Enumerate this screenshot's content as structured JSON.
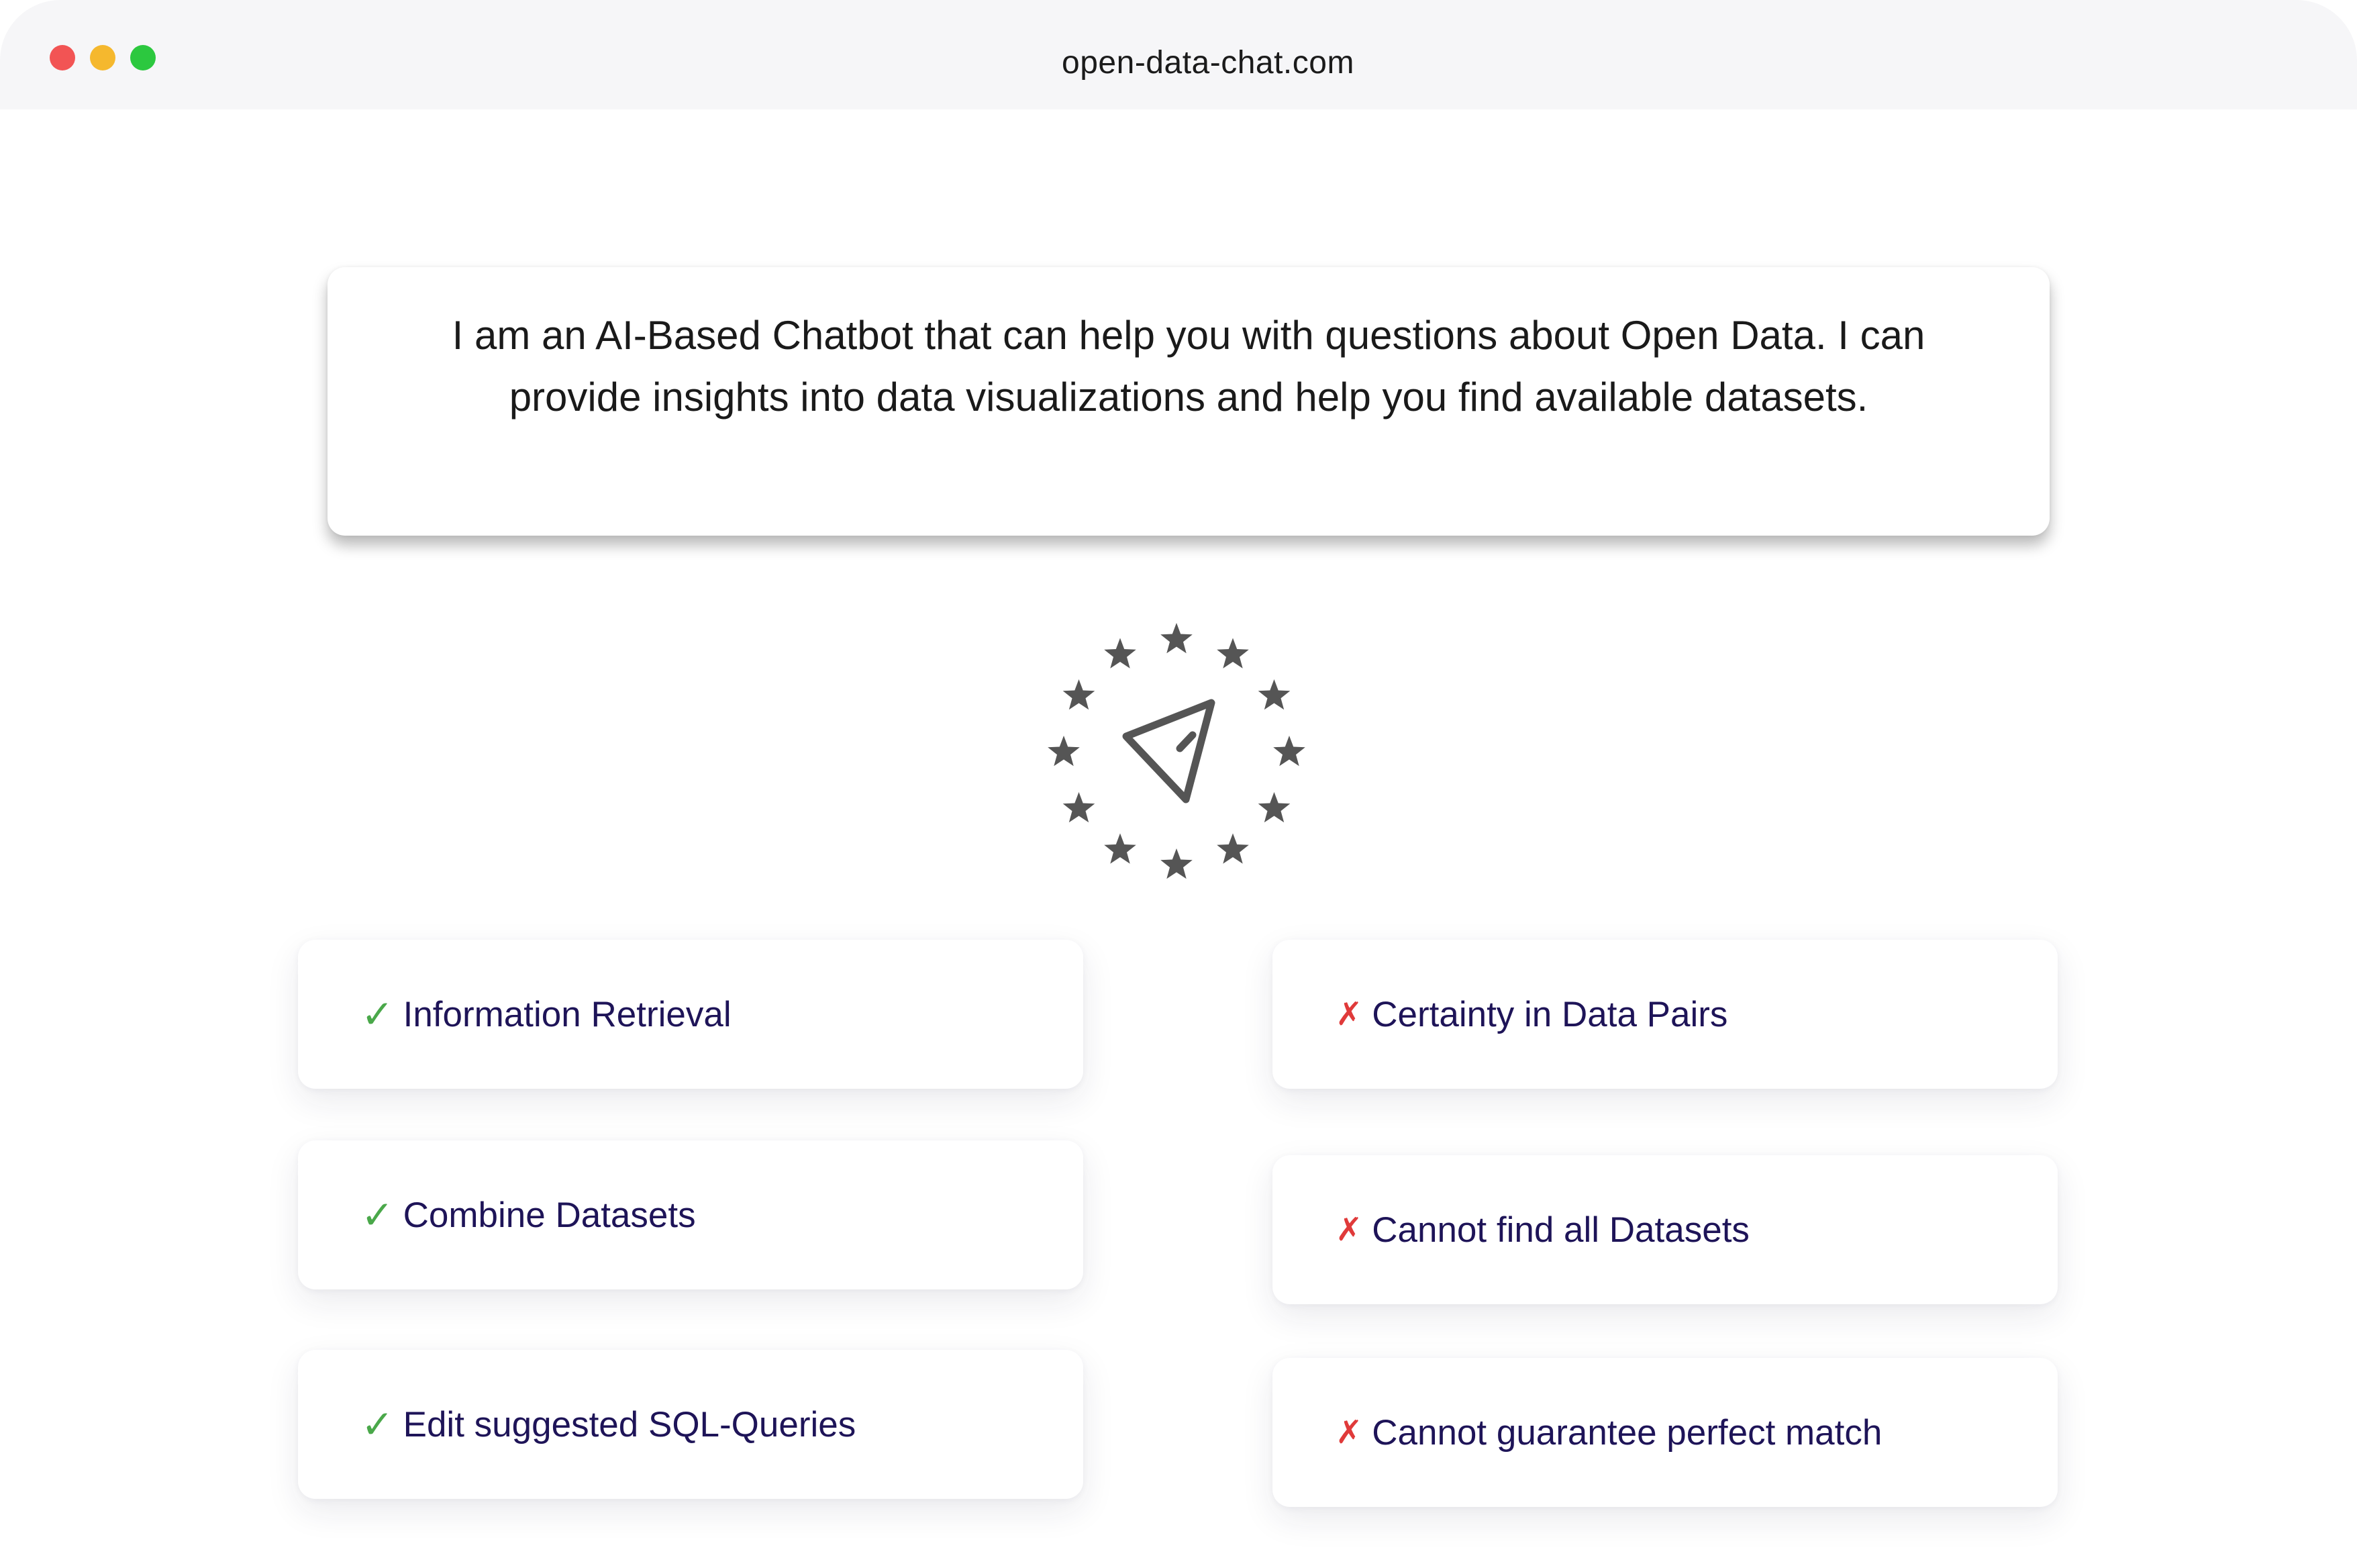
{
  "browser": {
    "url": "open-data-chat.com"
  },
  "intro": {
    "text": "I am an AI-Based Chatbot that can help you with questions about Open Data. I can provide insights into data visualizations and help you find available datasets."
  },
  "emblem": {
    "icon": "send-paper-plane-icon",
    "stars_icon": "eu-stars-icon",
    "color": "#555555"
  },
  "capabilities": [
    {
      "mark": "✓",
      "label": "Information Retrieval"
    },
    {
      "mark": "✓",
      "label": "Combine Datasets"
    },
    {
      "mark": "✓",
      "label": "Edit suggested SQL-Queries"
    }
  ],
  "limitations": [
    {
      "mark": "✗",
      "label": "Certainty in Data Pairs"
    },
    {
      "mark": "✗",
      "label": "Cannot find all Datasets"
    },
    {
      "mark": "✗",
      "label": "Cannot guarantee perfect match"
    }
  ],
  "colors": {
    "check": "#4aa84a",
    "cross": "#e03a3a",
    "label_text": "#1e1458",
    "traffic_red": "#f25454",
    "traffic_yellow": "#f5b82e",
    "traffic_green": "#2cc83f"
  }
}
